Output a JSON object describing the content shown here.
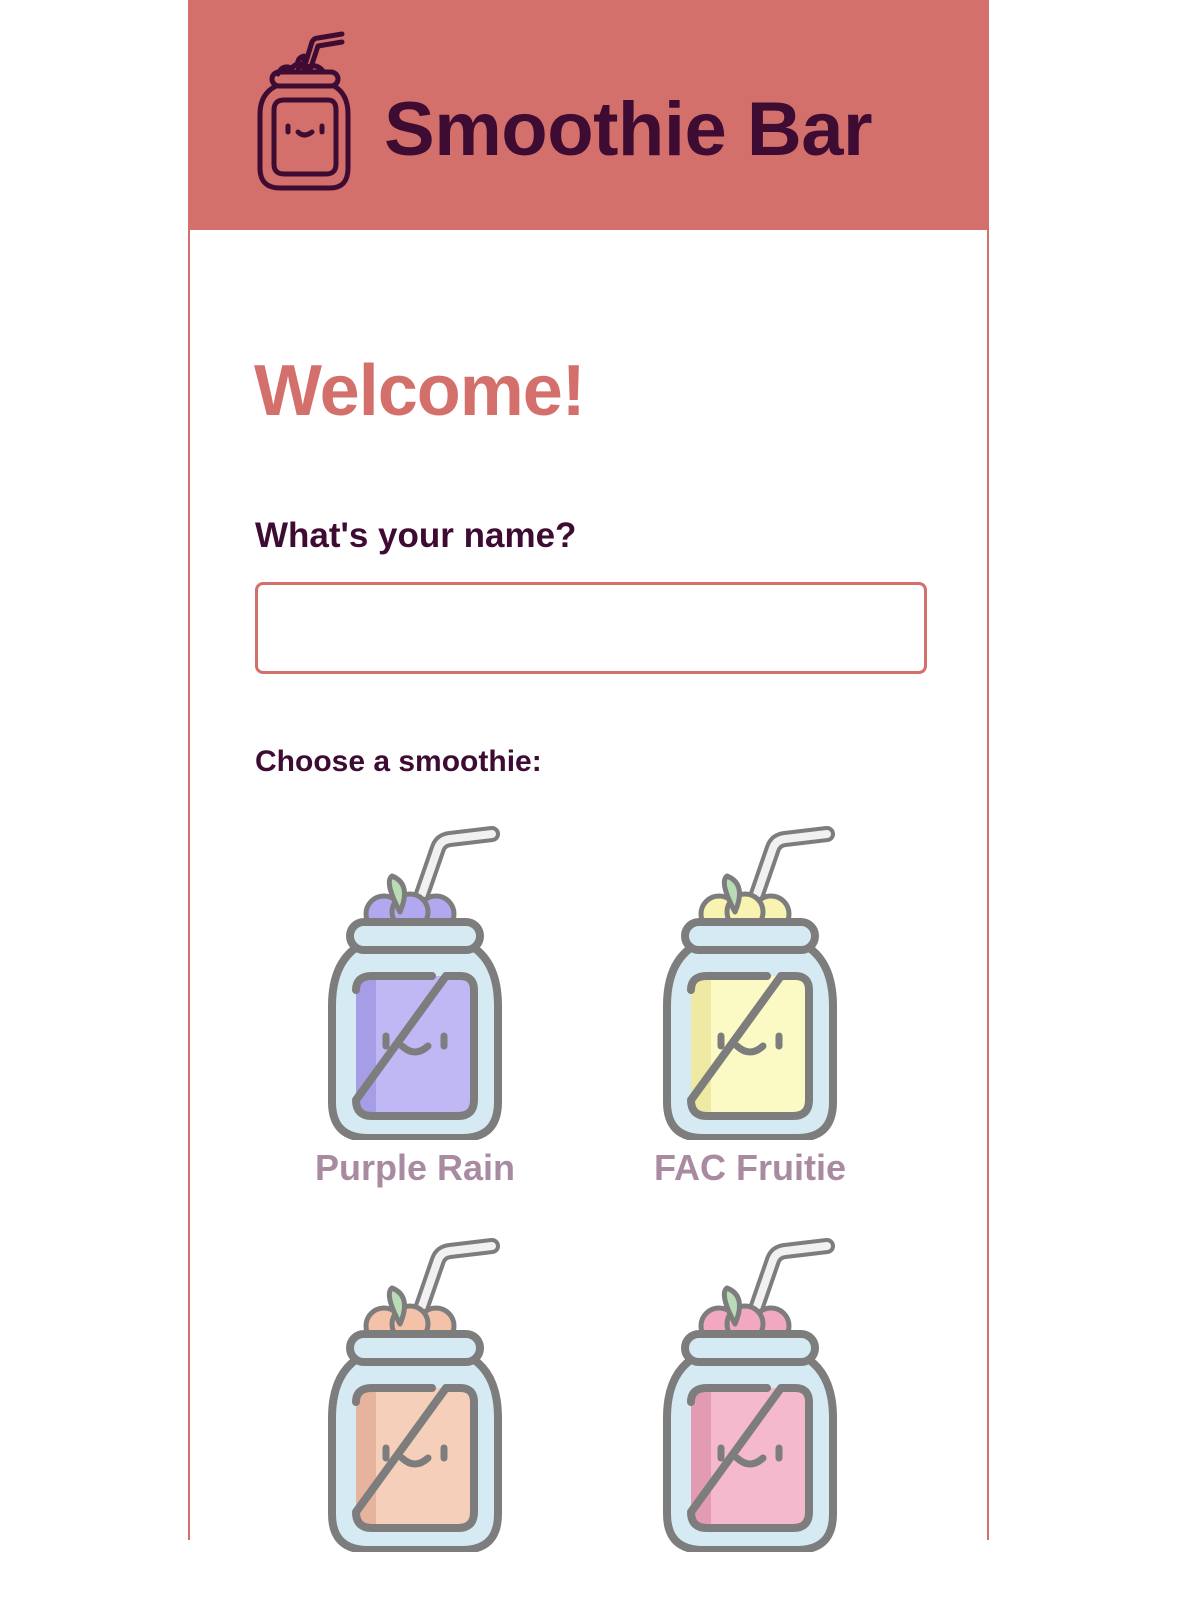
{
  "header": {
    "title": "Smoothie Bar",
    "logo_icon": "smoothie-jar-logo-icon",
    "background_color": "#d4706b",
    "title_color": "#3e0c33"
  },
  "main": {
    "heading": "Welcome!",
    "heading_color": "#d4706b",
    "name_label": "What's your name?",
    "name_input": {
      "value": "",
      "placeholder": ""
    },
    "choose_label": "Choose a smoothie:"
  },
  "smoothies": [
    {
      "name": "Purple Rain",
      "icon": "purple-smoothie-jar-icon",
      "color": "#bfb8f4",
      "shade": "#a59ee6",
      "fruit": "#b2a8f0"
    },
    {
      "name": "FAC Fruitie",
      "icon": "yellow-smoothie-jar-icon",
      "color": "#fbf9c4",
      "shade": "#eeeaa3",
      "fruit": "#f8f3b0"
    },
    {
      "name": "",
      "icon": "peach-smoothie-jar-icon",
      "color": "#f5cfba",
      "shade": "#e6b49c",
      "fruit": "#f3c2a8"
    },
    {
      "name": "",
      "icon": "pink-smoothie-jar-icon",
      "color": "#f4b9cd",
      "shade": "#e29bb3",
      "fruit": "#f2a8c0"
    }
  ]
}
